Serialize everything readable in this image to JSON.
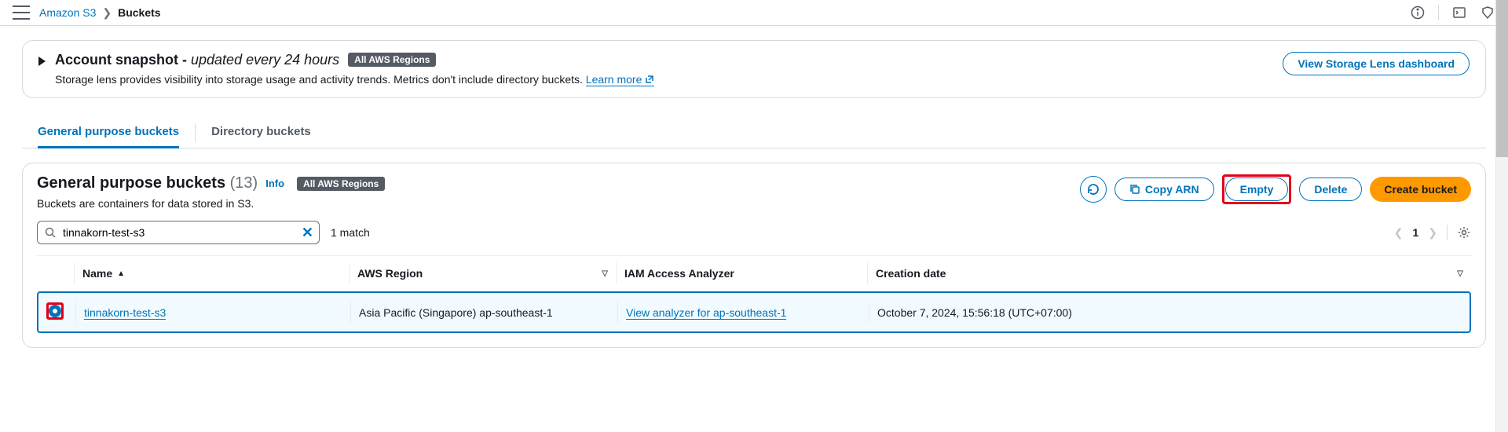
{
  "breadcrumb": {
    "root": "Amazon S3",
    "current": "Buckets"
  },
  "snapshot": {
    "title_prefix": "Account snapshot - ",
    "title_suffix": "updated every 24 hours",
    "badge": "All AWS Regions",
    "description_prefix": "Storage lens provides visibility into storage usage and activity trends. Metrics don't include directory buckets. ",
    "learn_more": "Learn more",
    "view_dashboard": "View Storage Lens dashboard"
  },
  "tabs": {
    "general": "General purpose buckets",
    "directory": "Directory buckets"
  },
  "section": {
    "title": "General purpose buckets",
    "count": "(13)",
    "info": "Info",
    "badge": "All AWS Regions",
    "description": "Buckets are containers for data stored in S3."
  },
  "actions": {
    "copy_arn": "Copy ARN",
    "empty": "Empty",
    "delete": "Delete",
    "create": "Create bucket"
  },
  "search": {
    "value": "tinnakorn-test-s3",
    "match": "1 match",
    "page": "1"
  },
  "columns": {
    "name": "Name",
    "region": "AWS Region",
    "iam": "IAM Access Analyzer",
    "date": "Creation date"
  },
  "rows": [
    {
      "name": "tinnakorn-test-s3",
      "region": "Asia Pacific (Singapore) ap-southeast-1",
      "iam": "View analyzer for ap-southeast-1",
      "date": "October 7, 2024, 15:56:18 (UTC+07:00)"
    }
  ]
}
